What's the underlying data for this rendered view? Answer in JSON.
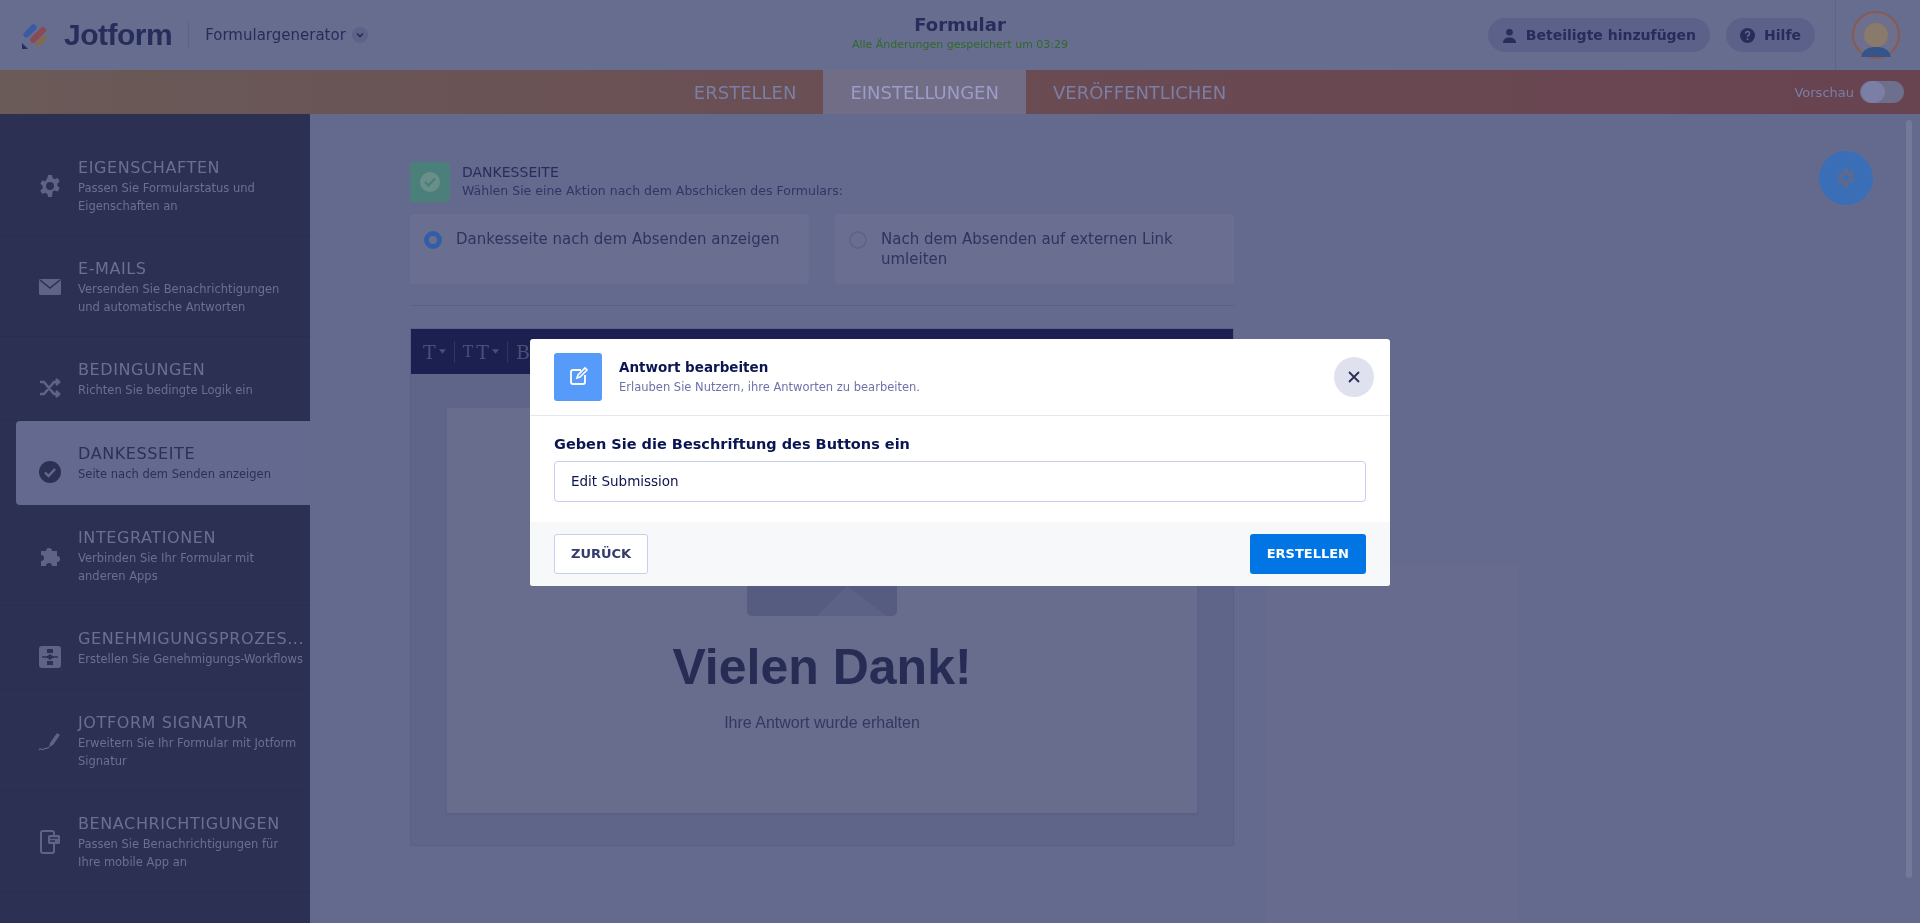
{
  "header": {
    "logo": "Jotform",
    "app_menu": "Formulargenerator",
    "title": "Formular",
    "save_status": "Alle Änderungen gespeichert um 03:29",
    "buttons": [
      {
        "label": "Beteiligte hinzufügen",
        "kind": "user"
      },
      {
        "label": "Hilfe",
        "kind": "help"
      }
    ]
  },
  "tabs": [
    {
      "label": "ERSTELLEN",
      "selected": false
    },
    {
      "label": "EINSTELLUNGEN",
      "selected": true
    },
    {
      "label": "VERÖFFENTLICHEN",
      "selected": false
    }
  ],
  "preview": {
    "label": "Vorschau",
    "on": false
  },
  "sidebar": {
    "items": [
      {
        "title": "EIGENSCHAFTEN",
        "description": "Passen Sie Formularstatus und Eigenschaften an",
        "kind": "gear",
        "selected": false
      },
      {
        "title": "E-MAILS",
        "description": "Versenden Sie Benachrichtigungen und automatische Antworten",
        "kind": "mail",
        "selected": false
      },
      {
        "title": "BEDINGUNGEN",
        "description": "Richten Sie bedingte Logik ein",
        "kind": "shuffle",
        "selected": false
      },
      {
        "title": "DANKESSEITE",
        "description": "Seite nach dem Senden anzeigen",
        "kind": "check",
        "selected": true
      },
      {
        "title": "INTEGRATIONEN",
        "description": "Verbinden Sie Ihr Formular mit anderen Apps",
        "kind": "puzzle",
        "selected": false
      },
      {
        "title": "GENEHMIGUNGSPROZES...",
        "description": "Erstellen Sie Genehmigungs-Workflows",
        "kind": "flow",
        "selected": false
      },
      {
        "title": "JOTFORM SIGNATUR",
        "description": "Erweitern Sie Ihr Formular mit Jotform Signatur",
        "kind": "pen",
        "selected": false
      },
      {
        "title": "BENACHRICHTIGUNGEN",
        "description": "Passen Sie Benachrichtigungen für Ihre mobile App an",
        "kind": "phone",
        "selected": false
      }
    ]
  },
  "section": {
    "title": "DANKESSEITE",
    "subtitle": "Wählen Sie eine Aktion nach dem Abschicken des Formulars:",
    "options": [
      {
        "label": "Dankesseite nach dem Absenden anzeigen",
        "selected": true
      },
      {
        "label": "Nach dem Absenden auf externen Link umleiten",
        "selected": false
      }
    ]
  },
  "editor": {
    "toolbar": [
      {
        "label": "T",
        "dropdown": true
      },
      {
        "label": "$_{T}$T",
        "dropdown": true
      },
      {
        "label": "B",
        "dropdown": false
      }
    ],
    "heading": "Vielen Dank!",
    "text": "Ihre Antwort wurde erhalten"
  },
  "dialog": {
    "title": "Antwort bearbeiten",
    "subtitle": "Erlauben Sie Nutzern, ihre Antworten zu bearbeiten.",
    "field_label": "Geben Sie die Beschriftung des Buttons ein",
    "field_value": "Edit Submission",
    "buttons": [
      {
        "label": "ZURÜCK",
        "kind": "secondary"
      },
      {
        "label": "ERSTELLEN",
        "kind": "primary"
      }
    ]
  }
}
